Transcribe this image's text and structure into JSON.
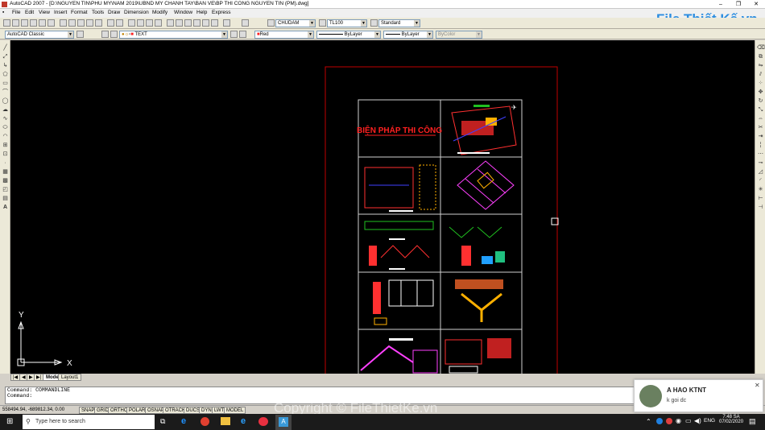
{
  "window": {
    "title": "AutoCAD 2007 - [D:\\NGUYEN TIN\\PHU MY\\NAM 2019\\UBND MY CHANH TAY\\BAN VE\\BP THI CONG NGUYEN TIN (PM).dwg]"
  },
  "menu": [
    "File",
    "Edit",
    "View",
    "Insert",
    "Format",
    "Tools",
    "Draw",
    "Dimension",
    "Modify",
    "Window",
    "Help",
    "Express"
  ],
  "toolbar": {
    "text_style": "CHUDAM",
    "dim_style": "TL100",
    "table_style": "Standard",
    "workspace": "AutoCAD Classic",
    "layer": "TEXT",
    "color": "Red",
    "linetype": "ByLayer",
    "lineweight": "ByLayer",
    "plotstyle": "ByColor"
  },
  "drawing": {
    "title_text": "BIỆN PHÁP THI CÔNG"
  },
  "ucs": {
    "y": "Y",
    "x": "X"
  },
  "tabs": {
    "model": "Model",
    "layout1": "Layout1"
  },
  "command": {
    "line1": "Command: COMMANDLINE",
    "line2": "Command:"
  },
  "status": {
    "coords": "558494.94, -689812.34, 0.00",
    "buttons": [
      "SNAP",
      "GRID",
      "ORTHO",
      "POLAR",
      "OSNAP",
      "OTRACK",
      "DUCS",
      "DYN",
      "LWT",
      "MODEL"
    ]
  },
  "taskbar": {
    "search_placeholder": "Type here to search",
    "lang": "ENG",
    "time": "7:48 SA",
    "date": "07/02/2020"
  },
  "notification": {
    "name": "A HAO KTNT",
    "message": "k goi dc"
  },
  "logo": {
    "text": "File Thiết Kế.vn"
  },
  "watermark": "Copyright © FileThietKe.vn",
  "colors": {
    "canvas": "#000000",
    "accent_red": "#ff2020",
    "logo_blue": "#2b8de0"
  }
}
